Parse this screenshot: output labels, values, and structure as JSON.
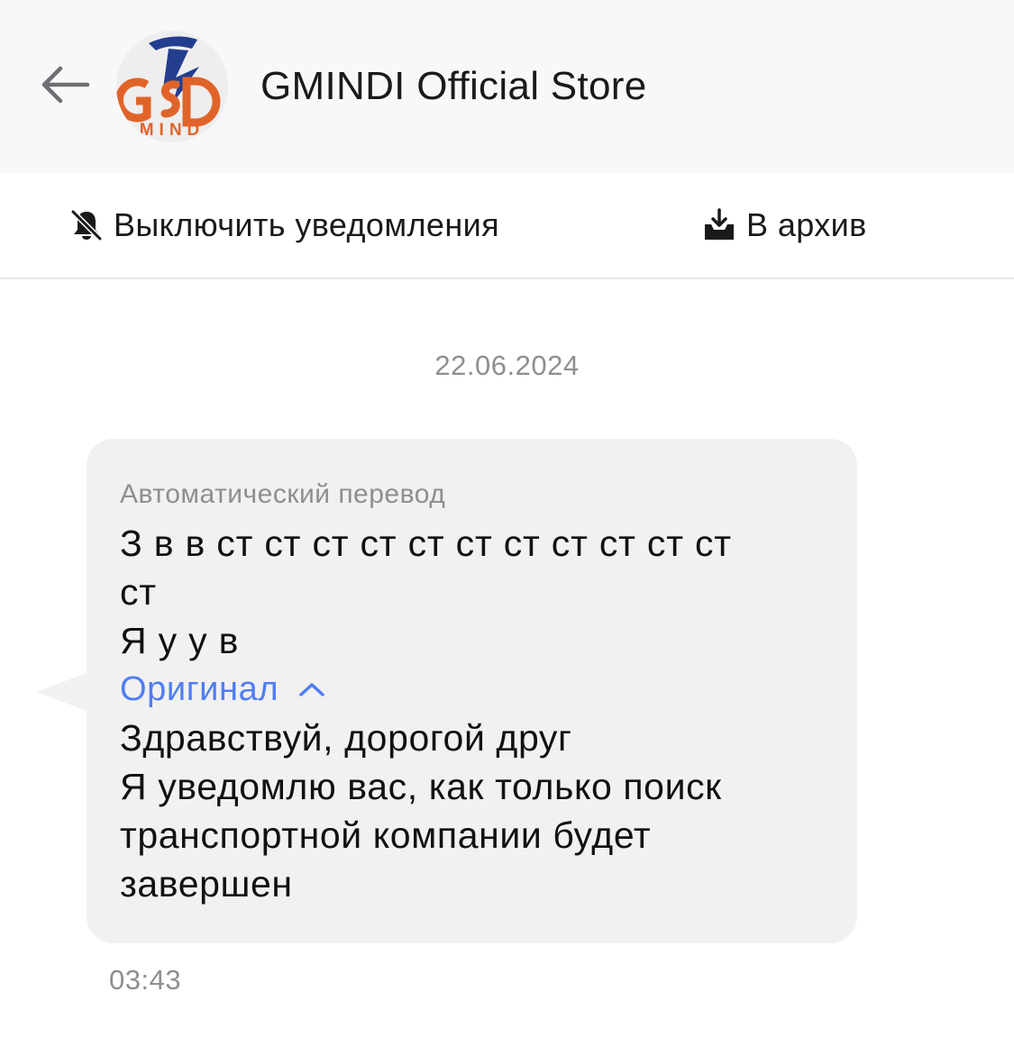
{
  "header": {
    "title": "GMINDI Official Store",
    "avatar_alt": "GMD MIND logo",
    "logo_letters": "GSD",
    "logo_subtext": "MIND",
    "back_icon": "arrow-left-icon"
  },
  "actions": {
    "mute_label": "Выключить уведомления",
    "mute_icon": "bell-off-icon",
    "archive_label": "В архив",
    "archive_icon": "archive-download-icon"
  },
  "chat": {
    "date": "22.06.2024",
    "message": {
      "auto_translate_label": "Автоматический перевод",
      "translated_text": "З в в ст ст ст ст ст ст ст ст ст ст ст\nст\nЯ у у в",
      "original_toggle_label": "Оригинал",
      "original_text": "Здравствуй, дорогой друг\nЯ уведомлю вас, как только поиск\nтранспортной компании будет\nзавершен",
      "time": "03:43"
    }
  },
  "colors": {
    "header_bg": "#f8f8f9",
    "bubble_bg": "#f1f1f2",
    "link_blue": "#4f7df3",
    "muted_gray": "#8e8e93",
    "logo_orange": "#e0642a",
    "logo_blue": "#243e8f"
  }
}
